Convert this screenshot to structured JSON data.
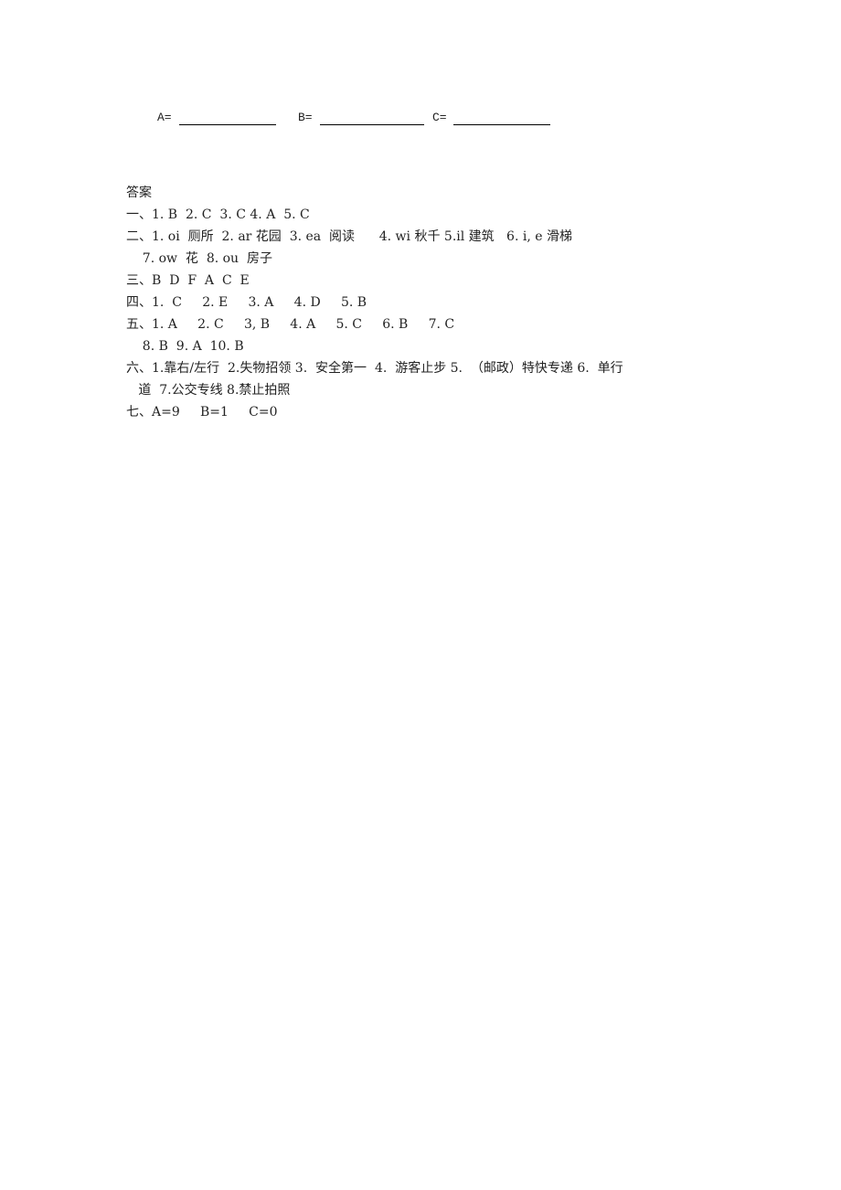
{
  "fill_in": {
    "a_label": "A=",
    "b_label": "B=",
    "c_label": "C="
  },
  "answers": {
    "heading": "答案",
    "lines": [
      "一、1. B  2. C  3. C 4. A  5. C",
      "二、1. oi  厕所  2. ar 花园  3. ea  阅读      4. wi 秋千 5.il 建筑   6. i, e 滑梯",
      "    7. ow  花  8. ou  房子",
      "三、B  D  F  A  C  E",
      "四、1.  C     2. E     3. A     4. D     5. B",
      "五、1. A     2. C     3, B     4. A     5. C     6. B     7. C",
      "    8. B  9. A  10. B",
      "六、1.靠右/左行  2.失物招领 3.  安全第一  4.  游客止步 5.  （邮政）特快专递 6.  单行",
      "   道  7.公交专线 8.禁止拍照",
      "七、A=9     B=1     C=0"
    ]
  }
}
